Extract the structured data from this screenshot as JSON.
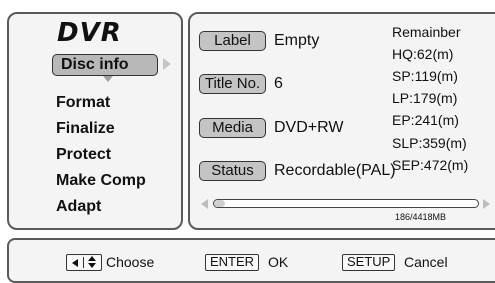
{
  "menu": {
    "title": "DVR",
    "items": [
      {
        "label": "Disc info",
        "selected": true
      },
      {
        "label": "Format"
      },
      {
        "label": "Finalize"
      },
      {
        "label": "Protect"
      },
      {
        "label": "Make Comp"
      },
      {
        "label": "Adapt"
      }
    ]
  },
  "disc_info": {
    "label_tag": "Label",
    "label_value": "Empty",
    "title_tag": "Title No.",
    "title_value": "6",
    "media_tag": "Media",
    "media_value": "DVD+RW",
    "status_tag": "Status",
    "status_value": "Recordable(PAL)"
  },
  "remaining": {
    "heading": "Remainber",
    "modes": [
      "HQ:62(m)",
      "SP:119(m)",
      "LP:179(m)",
      "EP:241(m)",
      "SLP:359(m)",
      "SEP:472(m)"
    ]
  },
  "usage": {
    "text": "186/4418MB",
    "fraction": 0.042
  },
  "help": {
    "choose_label": "Choose",
    "enter_key": "ENTER",
    "ok_label": "OK",
    "setup_key": "SETUP",
    "cancel_label": "Cancel"
  },
  "colors": {
    "panel_border": "#5a5a5a",
    "tag_fill": "#c4c4c4",
    "selected_fill": "#b8b8b8"
  }
}
